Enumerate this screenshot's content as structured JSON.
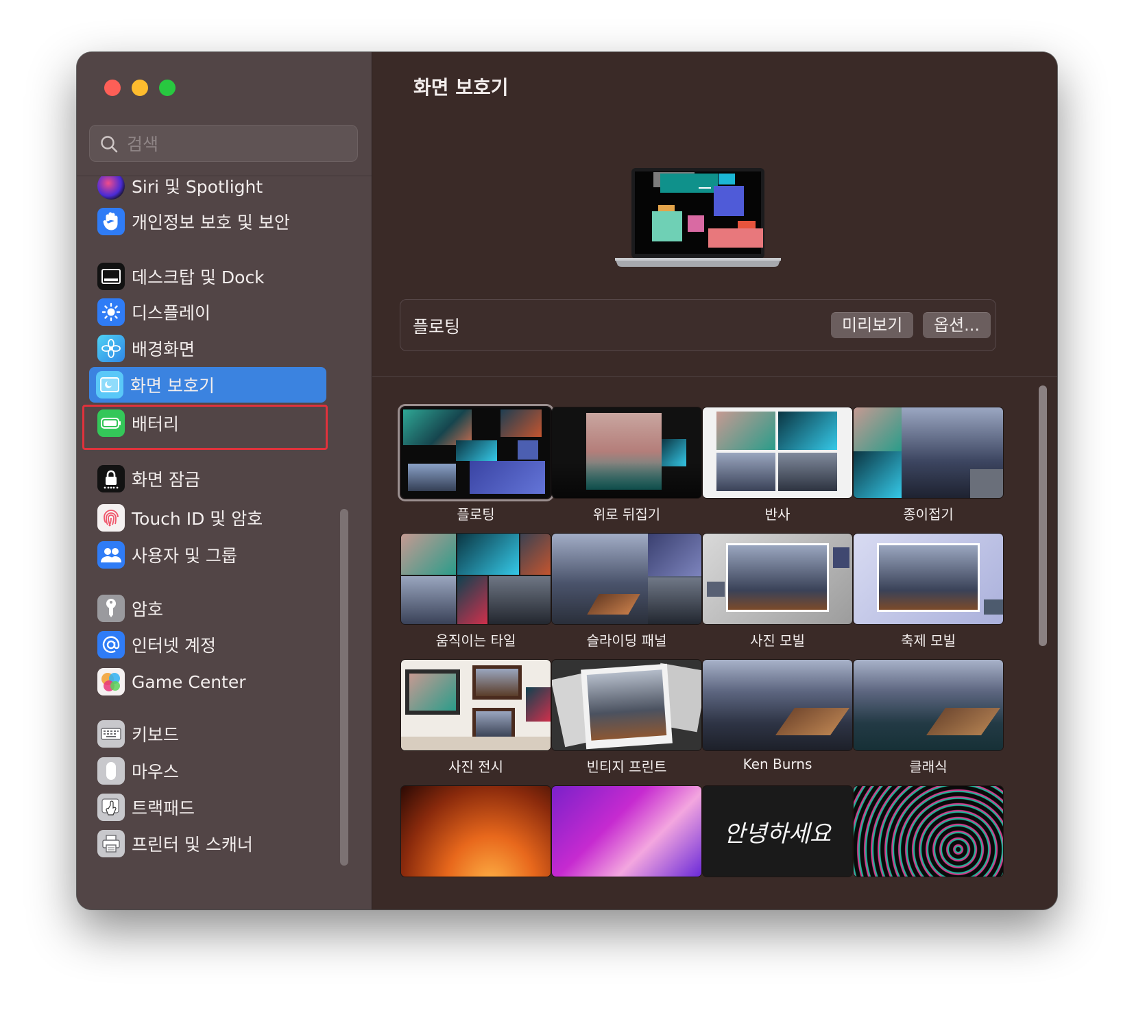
{
  "window": {
    "traffic_lights": [
      "close",
      "minimize",
      "zoom"
    ],
    "colors": {
      "sidebar": "#524546",
      "main": "#3a2a27",
      "accent": "#3b83e0",
      "highlight": "#e0323c"
    }
  },
  "search": {
    "placeholder": "검색",
    "value": ""
  },
  "sidebar": {
    "items": [
      {
        "label": "Siri 및 Spotlight",
        "icon": "siri-icon"
      },
      {
        "label": "개인정보 보호 및 보안",
        "icon": "hand-icon"
      },
      {
        "label": "데스크탑 및 Dock",
        "icon": "dock-icon"
      },
      {
        "label": "디스플레이",
        "icon": "sun-icon"
      },
      {
        "label": "배경화면",
        "icon": "flower-icon"
      },
      {
        "label": "화면 보호기",
        "icon": "screensaver-icon",
        "selected": true
      },
      {
        "label": "배터리",
        "icon": "battery-icon"
      },
      {
        "label": "화면 잠금",
        "icon": "lock-icon"
      },
      {
        "label": "Touch ID 및 암호",
        "icon": "fingerprint-icon"
      },
      {
        "label": "사용자 및 그룹",
        "icon": "users-icon"
      },
      {
        "label": "암호",
        "icon": "key-icon"
      },
      {
        "label": "인터넷 계정",
        "icon": "at-icon"
      },
      {
        "label": "Game Center",
        "icon": "game-center-icon"
      },
      {
        "label": "키보드",
        "icon": "keyboard-icon"
      },
      {
        "label": "마우스",
        "icon": "mouse-icon"
      },
      {
        "label": "트랙패드",
        "icon": "trackpad-icon"
      },
      {
        "label": "프린터 및 스캐너",
        "icon": "printer-icon"
      }
    ]
  },
  "main": {
    "title": "화면 보호기",
    "selected_saver": "플로팅",
    "preview_button": "미리보기",
    "options_button": "옵션...",
    "savers": [
      {
        "label": "플로팅",
        "selected": true
      },
      {
        "label": "위로 뒤집기"
      },
      {
        "label": "반사"
      },
      {
        "label": "종이접기"
      },
      {
        "label": "움직이는 타일"
      },
      {
        "label": "슬라이딩 패널"
      },
      {
        "label": "사진 모빌"
      },
      {
        "label": "축제 모빌"
      },
      {
        "label": "사진 전시"
      },
      {
        "label": "빈티지 프린트"
      },
      {
        "label": "Ken Burns"
      },
      {
        "label": "클래식"
      },
      {
        "label": ""
      },
      {
        "label": ""
      },
      {
        "label": "",
        "thumb_text": "안녕하세요"
      },
      {
        "label": ""
      }
    ]
  }
}
